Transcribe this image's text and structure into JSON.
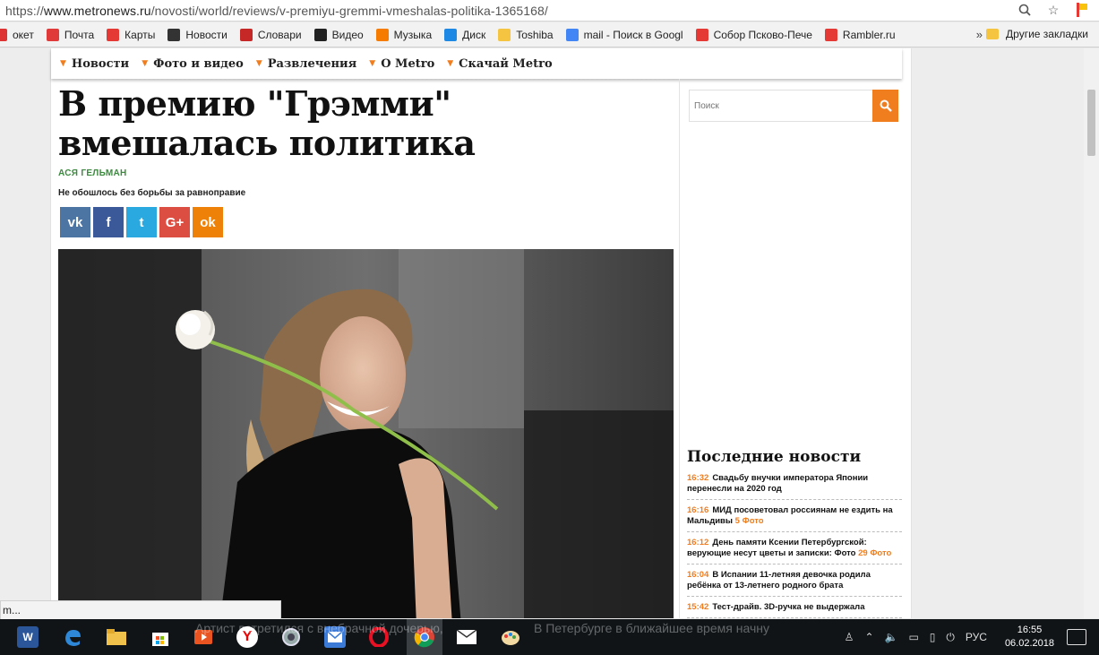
{
  "browser": {
    "url_prefix": "https://",
    "url_host": "www.metronews.ru",
    "url_path": "/novosti/world/reviews/v-premiyu-gremmi-vmeshalas-politika-1365168/",
    "bookmarks": [
      {
        "label": "окет",
        "color": "#d33"
      },
      {
        "label": "Почта",
        "color": "#e03a3a"
      },
      {
        "label": "Карты",
        "color": "#e53935"
      },
      {
        "label": "Новости",
        "color": "#333333"
      },
      {
        "label": "Словари",
        "color": "#c62828"
      },
      {
        "label": "Видео",
        "color": "#222222"
      },
      {
        "label": "Музыка",
        "color": "#f57c00"
      },
      {
        "label": "Диск",
        "color": "#1e88e5"
      },
      {
        "label": "Toshiba",
        "color": "#f5c542"
      },
      {
        "label": "mail - Поиск в Googl",
        "color": "#4285f4"
      },
      {
        "label": "Собор Псково-Пече",
        "color": "#e53935"
      },
      {
        "label": "Rambler.ru",
        "color": "#e53935"
      }
    ],
    "more_label": "»",
    "other_bookmarks": "Другие закладки"
  },
  "site": {
    "nav": [
      "Новости",
      "Фото и видео",
      "Развлечения",
      "О Metro",
      "Скачай Metro"
    ],
    "accent": "#f07d1e"
  },
  "article": {
    "title": "В премию \"Грэмми\" вмешалась политика",
    "author": "АСЯ ГЕЛЬМАН",
    "lead": "Не обошлось без борьбы за равноправие",
    "shares": [
      {
        "icon": "vk-icon",
        "glyph": "vk",
        "color": "#4c75a3"
      },
      {
        "icon": "facebook-icon",
        "glyph": "f",
        "color": "#3b5998"
      },
      {
        "icon": "twitter-icon",
        "glyph": "t",
        "color": "#2aa9e0"
      },
      {
        "icon": "google-plus-icon",
        "glyph": "G+",
        "color": "#dc4e41"
      },
      {
        "icon": "odnoklassniki-icon",
        "glyph": "ok",
        "color": "#ee8208"
      }
    ]
  },
  "sidebar": {
    "search_placeholder": "Поиск",
    "latest_title": "Последние новости",
    "news": [
      {
        "time": "16:32",
        "text": "Свадьбу внучки императора Японии перенесли на 2020 год",
        "extra": ""
      },
      {
        "time": "16:16",
        "text": "МИД посоветовал россиянам не ездить на Мальдивы",
        "extra": "5 Фото"
      },
      {
        "time": "16:12",
        "text": "День памяти Ксении Петербургской: верующие несут цветы и записки: Фото",
        "extra": "29 Фото"
      },
      {
        "time": "16:04",
        "text": "В Испании 11-летняя девочка родила ребёнка от 13-летнего родного брата",
        "extra": ""
      },
      {
        "time": "15:42",
        "text": "Тест-драйв. 3D-ручка не выдержала",
        "extra": ""
      }
    ]
  },
  "status": "m...",
  "taskbar": {
    "ghost_left": "Артист встретился с внебрачной дочерью,",
    "ghost_right": "В Петербурге в ближайшее время начну",
    "lang": "РУС",
    "time": "16:55",
    "date": "06.02.2018"
  }
}
